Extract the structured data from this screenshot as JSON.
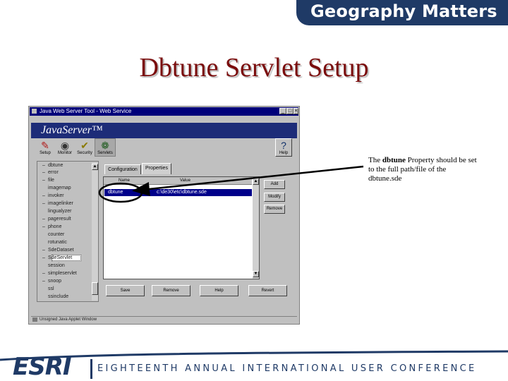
{
  "banner": {
    "text": "Geography Matters"
  },
  "slide": {
    "title": "Dbtune Servlet Setup"
  },
  "window": {
    "title": "Java Web Server Tool - Web Service",
    "minimize": "_",
    "maximize": "□",
    "close": "×",
    "logo": "JavaServer™"
  },
  "toolbar": {
    "items": [
      {
        "label": "Setup"
      },
      {
        "label": "Monitor"
      },
      {
        "label": "Security"
      },
      {
        "label": "Servlets"
      }
    ],
    "help_label": "Help"
  },
  "tree": {
    "items": [
      "dbtune",
      "error",
      "file",
      "imagemap",
      "invoker",
      "imagelinker",
      "lingualyzer",
      "pageresult",
      "phone",
      "counter",
      "rotunatic",
      "SdeDataset",
      "SdeServlet",
      "session",
      "simpleservlet",
      "snoop",
      "ssl",
      "ssinclude"
    ],
    "selected": "SdeServlet"
  },
  "tabs": {
    "configuration": "Configuration",
    "properties": "Properties"
  },
  "table": {
    "headers": [
      "Name",
      "Value"
    ],
    "selected_row": {
      "name": "dbtune",
      "value": "c:\\de30\\etc\\dbtune.sde"
    }
  },
  "side_buttons": {
    "add": "Add",
    "modify": "Modify",
    "remove": "Remove"
  },
  "bottom_buttons": {
    "save": "Save",
    "remove": "Remove",
    "help": "Help",
    "revert": "Revert"
  },
  "status": {
    "text": "Unsigned Java Applet Window"
  },
  "annotation": {
    "pre": "The ",
    "bold": "dbtune",
    "post": " Property should be set to the full path/file of the dbtune.sde"
  },
  "footer": {
    "logo": "ESRI",
    "text": "EIGHTEENTH ANNUAL INTERNATIONAL USER CONFERENCE"
  },
  "colors": {
    "brand_navy": "#1f3a66",
    "title_red": "#7a0c0c",
    "selection_blue": "#00008a"
  }
}
